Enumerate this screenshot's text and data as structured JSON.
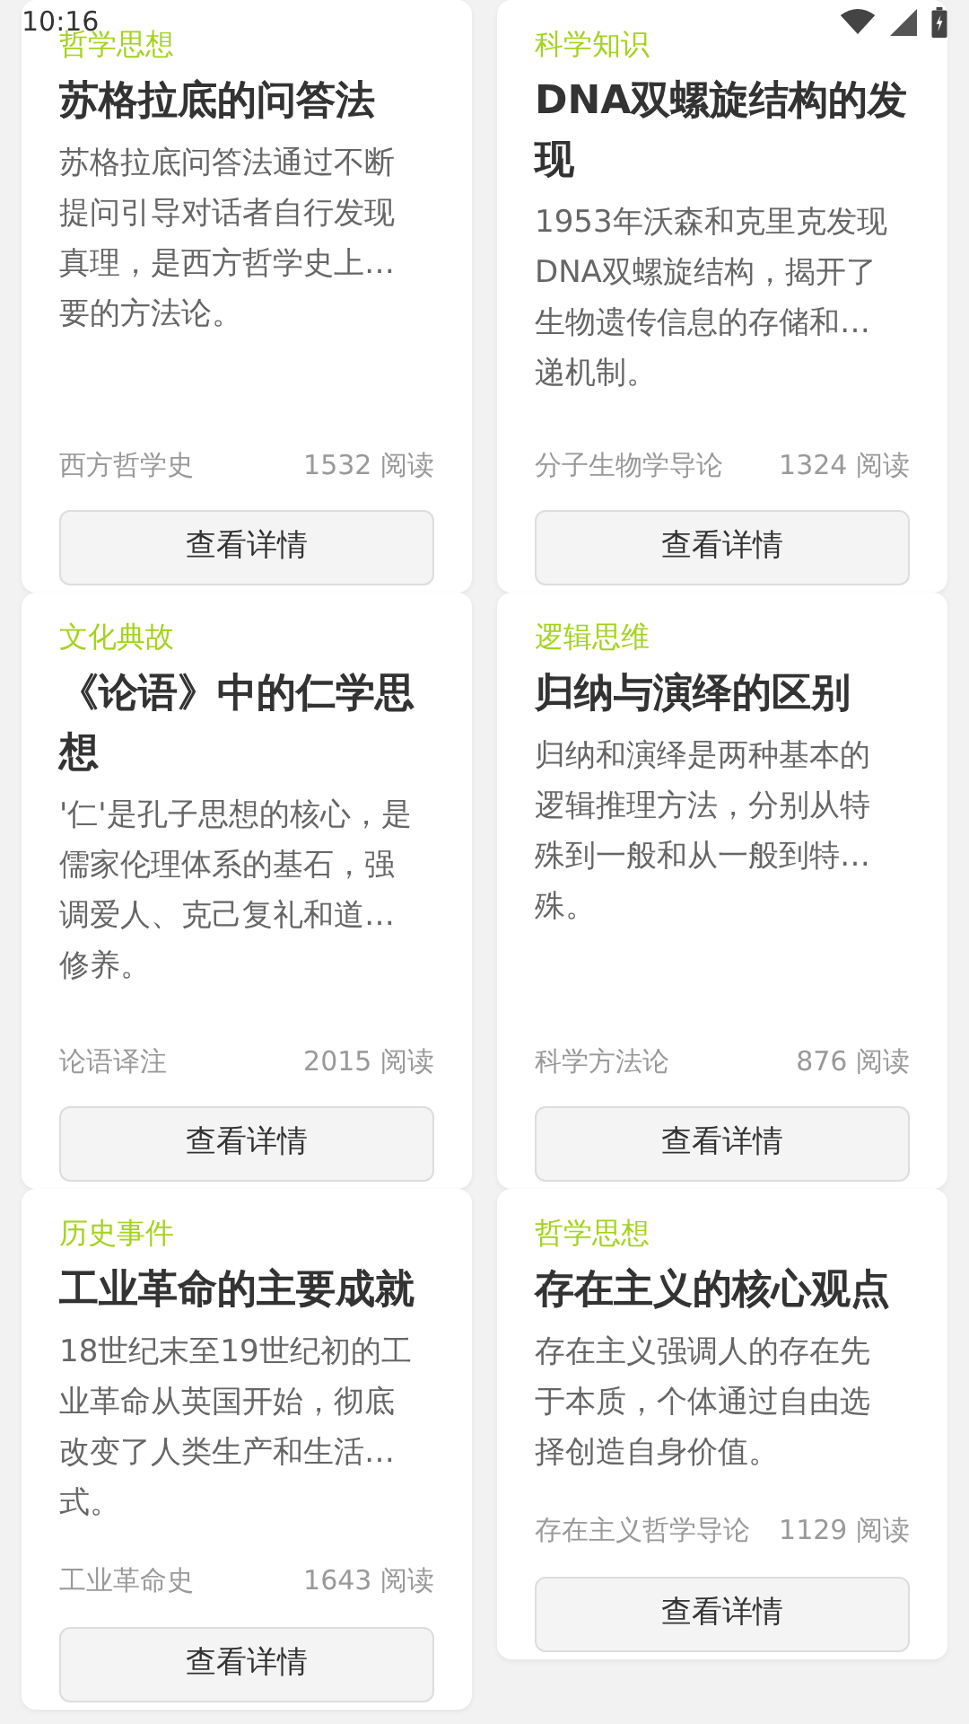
{
  "status_bar": {
    "time": "10:16"
  },
  "cards": [
    {
      "category": "哲学思想",
      "title": "苏格拉底的问答法",
      "description_lines": [
        "苏格拉底问答法通过不断",
        "提问引导对话者自行发现",
        "真理，是西方哲学史上…",
        "要的方法论。"
      ],
      "source": "西方哲学史",
      "reads": "1532 阅读",
      "button": "查看详情"
    },
    {
      "category": "科学知识",
      "title": "DNA双螺旋结构的发现",
      "description_lines": [
        "1953年沃森和克里克发现",
        "DNA双螺旋结构，揭开了",
        "生物遗传信息的存储和…",
        "递机制。"
      ],
      "source": "分子生物学导论",
      "reads": "1324 阅读",
      "button": "查看详情"
    },
    {
      "category": "文化典故",
      "title": "《论语》中的仁学思想",
      "description_lines": [
        "'仁'是孔子思想的核心，是",
        "儒家伦理体系的基石，强",
        "调爱人、克己复礼和道…",
        "修养。"
      ],
      "source": "论语译注",
      "reads": "2015 阅读",
      "button": "查看详情"
    },
    {
      "category": "逻辑思维",
      "title": "归纳与演绎的区别",
      "description_lines": [
        "归纳和演绎是两种基本的",
        "逻辑推理方法，分别从特",
        "殊到一般和从一般到特…",
        "殊。"
      ],
      "source": "科学方法论",
      "reads": "876 阅读",
      "button": "查看详情"
    },
    {
      "category": "历史事件",
      "title": "工业革命的主要成就",
      "description_lines": [
        "18世纪末至19世纪初的工",
        "业革命从英国开始，彻底",
        "改变了人类生产和生活…",
        "式。"
      ],
      "source": "工业革命史",
      "reads": "1643 阅读",
      "button": "查看详情"
    },
    {
      "category": "哲学思想",
      "title": "存在主义的核心观点",
      "description_lines": [
        "存在主义强调人的存在先",
        "于本质，个体通过自由选",
        "择创造自身价值。"
      ],
      "source": "存在主义哲学导论",
      "reads": "1129 阅读",
      "button": "查看详情"
    }
  ]
}
